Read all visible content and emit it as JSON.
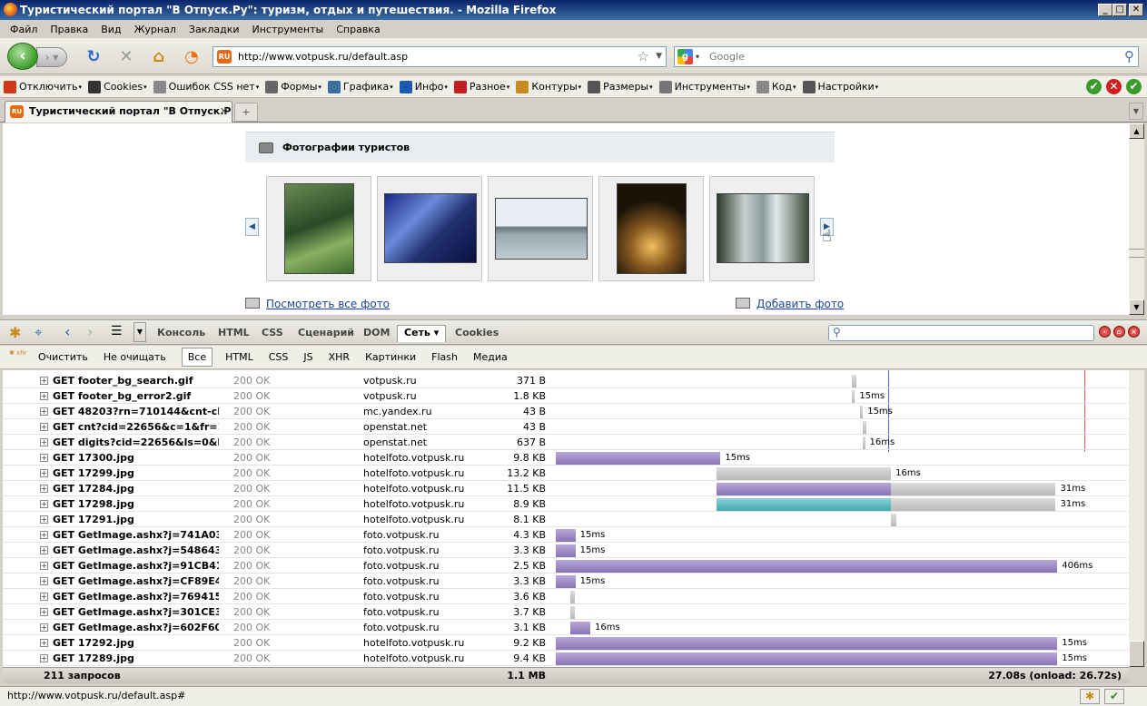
{
  "window": {
    "title": "Туристический портал \"В Отпуск.Ру\": туризм, отдых и путешествия. - Mozilla Firefox"
  },
  "menu": [
    "Файл",
    "Правка",
    "Вид",
    "Журнал",
    "Закладки",
    "Инструменты",
    "Справка"
  ],
  "nav": {
    "url": "http://www.votpusk.ru/default.asp",
    "search_placeholder": "Google"
  },
  "devtoolbar": [
    {
      "label": "Отключить",
      "icon": "disable-icon",
      "color": "#d03a1a"
    },
    {
      "label": "Cookies",
      "icon": "cookies-icon",
      "color": "#333333"
    },
    {
      "label": "Ошибок CSS нет",
      "icon": "css-wand-icon",
      "color": "#888888"
    },
    {
      "label": "Формы",
      "icon": "forms-icon",
      "color": "#666666"
    },
    {
      "label": "Графика",
      "icon": "images-icon",
      "color": "#3a6ea5"
    },
    {
      "label": "Инфо",
      "icon": "info-icon",
      "color": "#1a5ab0"
    },
    {
      "label": "Разное",
      "icon": "misc-icon",
      "color": "#c02020"
    },
    {
      "label": "Контуры",
      "icon": "outline-icon",
      "color": "#c88a20"
    },
    {
      "label": "Размеры",
      "icon": "resize-icon",
      "color": "#555555"
    },
    {
      "label": "Инструменты",
      "icon": "tools-icon",
      "color": "#777777"
    },
    {
      "label": "Код",
      "icon": "source-icon",
      "color": "#888888"
    },
    {
      "label": "Настройки",
      "icon": "options-icon",
      "color": "#555555"
    }
  ],
  "tab": {
    "title": "Туристический портал \"В Отпуск.Р...",
    "close": "✕",
    "new": "+"
  },
  "page": {
    "photos_title": "Фотографии туристов",
    "view_all": "Посмотреть все фото",
    "add_photo": "Добавить фото"
  },
  "firebug": {
    "tabs": [
      "Консоль",
      "HTML",
      "CSS",
      "Сценарий",
      "DOM",
      "Сеть",
      "Cookies"
    ],
    "selected_tab": "Сеть",
    "net_buttons": [
      "Очистить",
      "Не очищать",
      "Все",
      "HTML",
      "CSS",
      "JS",
      "XHR",
      "Картинки",
      "Flash",
      "Медиа"
    ],
    "net_selected": "Все",
    "rows": [
      {
        "url": "GET footer_bg_search.gif",
        "status": "200 OK",
        "domain": "votpusk.ru",
        "size": "371 B",
        "time": "",
        "start": 0.558,
        "wait": 0.008,
        "recv": 0
      },
      {
        "url": "GET footer_bg_error2.gif",
        "status": "200 OK",
        "domain": "votpusk.ru",
        "size": "1.8 KB",
        "time": "15ms",
        "start": 0.558,
        "wait": 0.004,
        "recv": 0
      },
      {
        "url": "GET 48203?rn=710144&cnt-clas",
        "status": "200 OK",
        "domain": "mc.yandex.ru",
        "size": "43 B",
        "time": "15ms",
        "start": 0.573,
        "wait": 0.002,
        "recv": 0
      },
      {
        "url": "GET cnt?cid=22656&c=1&fr=1&",
        "status": "200 OK",
        "domain": "openstat.net",
        "size": "43 B",
        "time": "",
        "start": 0.577,
        "wait": 0.008,
        "recv": 0
      },
      {
        "url": "GET digits?cid=22656&ls=0&ln=",
        "status": "200 OK",
        "domain": "openstat.net",
        "size": "637 B",
        "time": "16ms",
        "start": 0.577,
        "wait": 0.004,
        "recv": 0
      },
      {
        "url": "GET 17300.jpg",
        "status": "200 OK",
        "domain": "hotelfoto.votpusk.ru",
        "size": "9.8 KB",
        "time": "15ms",
        "start": 0,
        "wait": 0,
        "recv": 0.31
      },
      {
        "url": "GET 17299.jpg",
        "status": "200 OK",
        "domain": "hotelfoto.votpusk.ru",
        "size": "13.2 KB",
        "time": "16ms",
        "start": 0.303,
        "wait": 0.328,
        "recv": 0
      },
      {
        "url": "GET 17284.jpg",
        "status": "200 OK",
        "domain": "hotelfoto.votpusk.ru",
        "size": "11.5 KB",
        "time": "31ms",
        "start": 0.303,
        "wait": 0.0,
        "recv": 0.328,
        "tail": 0.31
      },
      {
        "url": "GET 17298.jpg",
        "status": "200 OK",
        "domain": "hotelfoto.votpusk.ru",
        "size": "8.9 KB",
        "time": "31ms",
        "start": 0.303,
        "cache": 0.328,
        "tail": 0.31
      },
      {
        "url": "GET 17291.jpg",
        "status": "200 OK",
        "domain": "hotelfoto.votpusk.ru",
        "size": "8.1 KB",
        "time": "",
        "start": 0.631,
        "wait": 0.01,
        "recv": 0
      },
      {
        "url": "GET GetImage.ashx?j=741A036I",
        "status": "200 OK",
        "domain": "foto.votpusk.ru",
        "size": "4.3 KB",
        "time": "15ms",
        "start": 0,
        "wait": 0,
        "recv": 0.037
      },
      {
        "url": "GET GetImage.ashx?j=548643D",
        "status": "200 OK",
        "domain": "foto.votpusk.ru",
        "size": "3.3 KB",
        "time": "15ms",
        "start": 0,
        "wait": 0,
        "recv": 0.037
      },
      {
        "url": "GET GetImage.ashx?j=91CB41D",
        "status": "200 OK",
        "domain": "foto.votpusk.ru",
        "size": "2.5 KB",
        "time": "406ms",
        "start": 0,
        "wait": 0,
        "recv": 0.944
      },
      {
        "url": "GET GetImage.ashx?j=CF89E4E",
        "status": "200 OK",
        "domain": "foto.votpusk.ru",
        "size": "3.3 KB",
        "time": "15ms",
        "start": 0,
        "wait": 0,
        "recv": 0.037
      },
      {
        "url": "GET GetImage.ashx?j=7694151",
        "status": "200 OK",
        "domain": "foto.votpusk.ru",
        "size": "3.6 KB",
        "time": "",
        "start": 0.028,
        "wait": 0.008,
        "recv": 0
      },
      {
        "url": "GET GetImage.ashx?j=301CE3B",
        "status": "200 OK",
        "domain": "foto.votpusk.ru",
        "size": "3.7 KB",
        "time": "",
        "start": 0.028,
        "wait": 0.008,
        "recv": 0
      },
      {
        "url": "GET GetImage.ashx?j=602F608",
        "status": "200 OK",
        "domain": "foto.votpusk.ru",
        "size": "3.1 KB",
        "time": "16ms",
        "start": 0.028,
        "wait": 0,
        "recv": 0.037
      },
      {
        "url": "GET 17292.jpg",
        "status": "200 OK",
        "domain": "hotelfoto.votpusk.ru",
        "size": "9.2 KB",
        "time": "15ms",
        "start": 0,
        "wait": 0,
        "recv": 0.944
      },
      {
        "url": "GET 17289.jpg",
        "status": "200 OK",
        "domain": "hotelfoto.votpusk.ru",
        "size": "9.4 KB",
        "time": "15ms",
        "start": 0,
        "wait": 0,
        "recv": 0.944
      }
    ],
    "summary": {
      "count": "211 запросов",
      "size": "1.1 MB",
      "time": "27.08s (onload: 26.72s)"
    }
  },
  "status": {
    "text": "http://www.votpusk.ru/default.asp#"
  }
}
